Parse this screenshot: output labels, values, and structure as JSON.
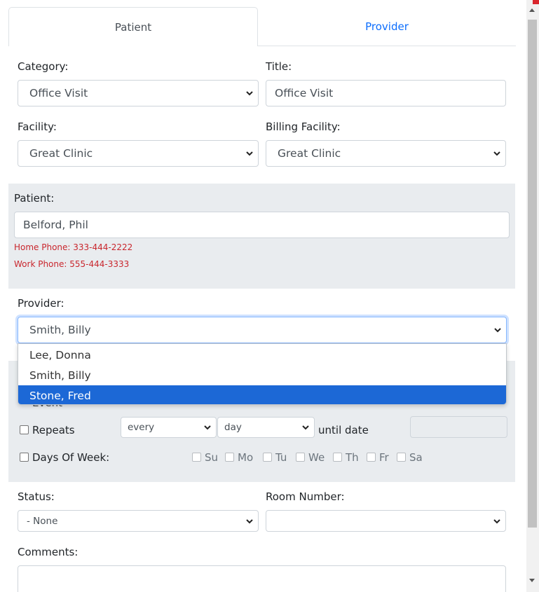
{
  "tabs": {
    "patient": "Patient",
    "provider": "Provider"
  },
  "category": {
    "label": "Category:",
    "value": "Office Visit"
  },
  "title": {
    "label": "Title:",
    "value": "Office Visit"
  },
  "facility": {
    "label": "Facility:",
    "value": "Great Clinic"
  },
  "billing_facility": {
    "label": "Billing Facility:",
    "value": "Great Clinic"
  },
  "patient": {
    "label": "Patient:",
    "value": "Belford, Phil",
    "home_phone": "Home Phone: 333-444-2222",
    "work_phone": "Work Phone: 555-444-3333"
  },
  "provider": {
    "label": "Provider:",
    "value": "Smith, Billy",
    "options": [
      "Lee, Donna",
      "Smith, Billy",
      "Stone, Fred"
    ],
    "highlighted": "Stone, Fred"
  },
  "repeat": {
    "obscured_label": "Event",
    "repeats_label": "Repeats",
    "every_value": "every",
    "unit_value": "day",
    "until_label": "until date",
    "days_of_week_label": "Days Of Week:",
    "days": [
      "Su",
      "Mo",
      "Tu",
      "We",
      "Th",
      "Fr",
      "Sa"
    ]
  },
  "status": {
    "label": "Status:",
    "value": "- None"
  },
  "room_number": {
    "label": "Room Number:",
    "value": ""
  },
  "comments": {
    "label": "Comments:"
  },
  "icons": {
    "chevron": "chevron-down-icon",
    "scroll_up": "scroll-up-arrow-icon",
    "scroll_down": "scroll-down-arrow-icon"
  }
}
